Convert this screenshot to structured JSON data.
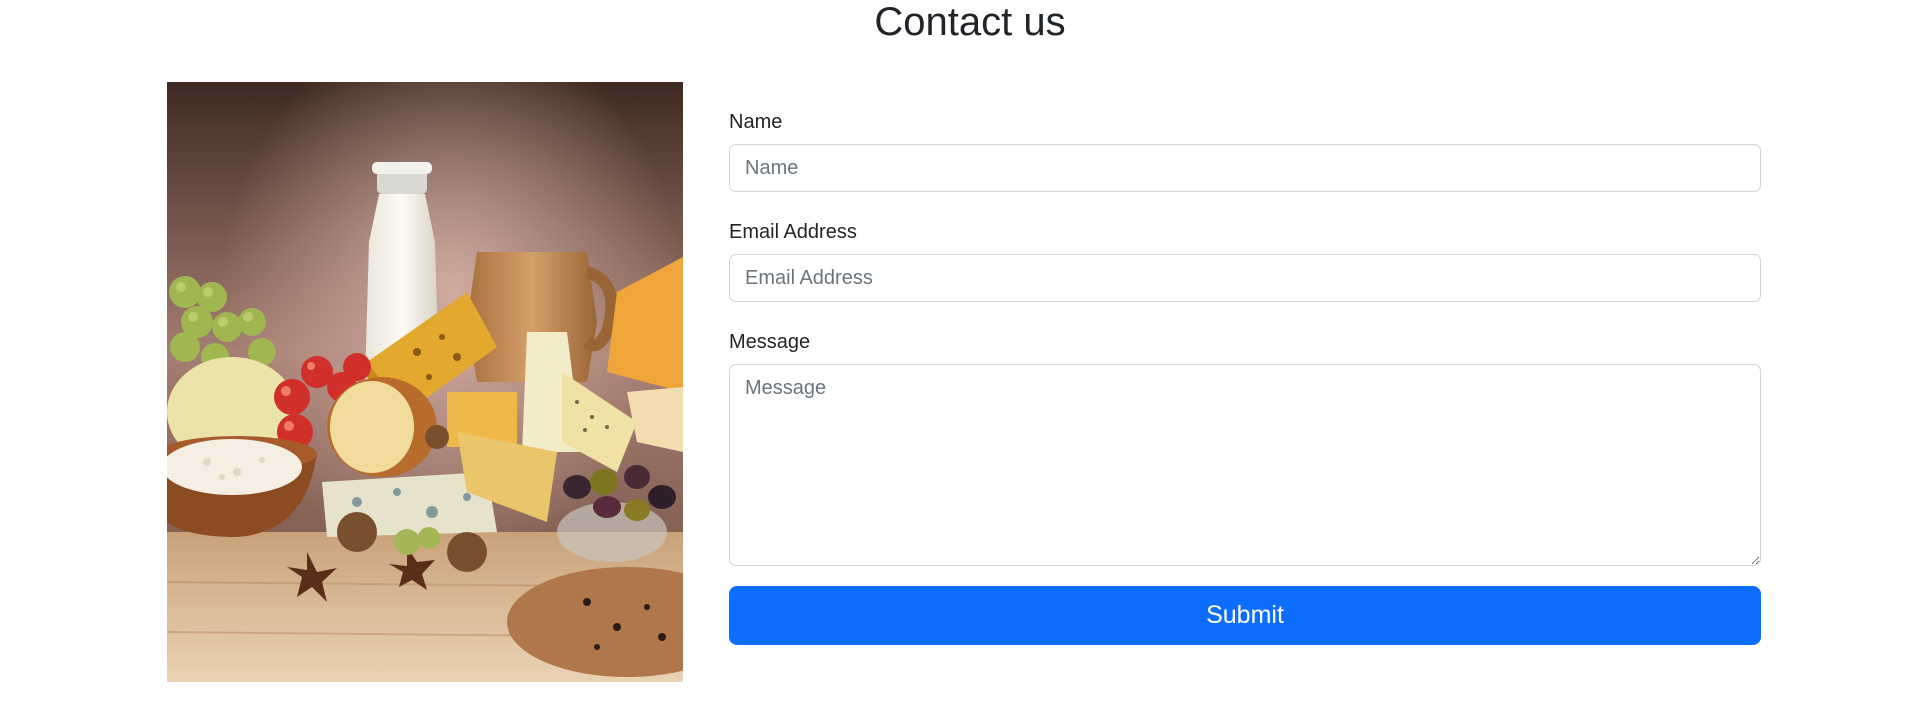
{
  "page": {
    "title": "Contact us"
  },
  "image": {
    "subject": "dairy-products-photo",
    "alt": ""
  },
  "form": {
    "name": {
      "label": "Name",
      "placeholder": "Name",
      "value": ""
    },
    "email": {
      "label": "Email Address",
      "placeholder": "Email Address",
      "value": ""
    },
    "message": {
      "label": "Message",
      "placeholder": "Message",
      "value": ""
    },
    "submit_label": "Submit"
  },
  "colors": {
    "primary": "#0d6efd",
    "text": "#212529",
    "placeholder": "#6c757d",
    "border": "#ced4da"
  }
}
